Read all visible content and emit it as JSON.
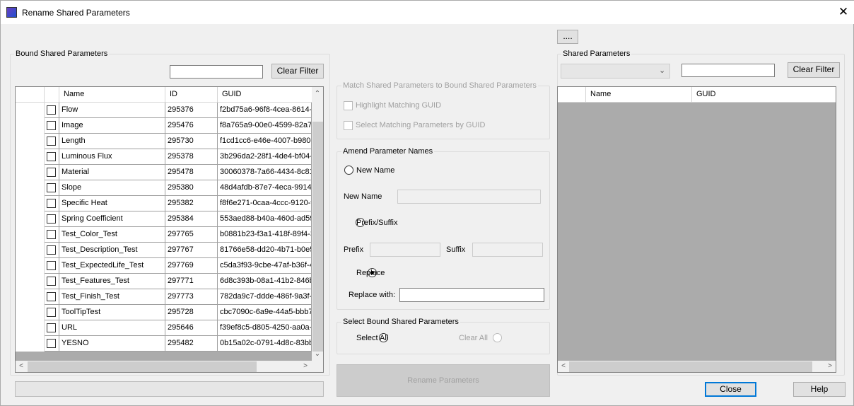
{
  "window": {
    "title": "Rename Shared Parameters",
    "close_icon": "close-icon"
  },
  "browse_button": "....",
  "bound": {
    "group_label": "Bound Shared Parameters",
    "filter_value": "",
    "clear_filter": "Clear Filter",
    "columns": [
      "Name",
      "ID",
      "GUID"
    ],
    "rows": [
      {
        "name": "Flow",
        "id": "295376",
        "guid": "f2bd75a6-96f8-4cea-8614-e"
      },
      {
        "name": "Image",
        "id": "295476",
        "guid": "f8a765a9-00e0-4599-82a7-"
      },
      {
        "name": "Length",
        "id": "295730",
        "guid": "f1cd1cc6-e46e-4007-b980-"
      },
      {
        "name": "Luminous Flux",
        "id": "295378",
        "guid": "3b296da2-28f1-4de4-bf04-c"
      },
      {
        "name": "Material",
        "id": "295478",
        "guid": "30060378-7a66-4434-8c81"
      },
      {
        "name": "Slope",
        "id": "295380",
        "guid": "48d4afdb-87e7-4eca-9914-"
      },
      {
        "name": "Specific Heat",
        "id": "295382",
        "guid": "f8f6e271-0caa-4ccc-9120-f"
      },
      {
        "name": "Spring Coefficient",
        "id": "295384",
        "guid": "553aed88-b40a-460d-ad59"
      },
      {
        "name": "Test_Color_Test",
        "id": "297765",
        "guid": "b0881b23-f3a1-418f-89f4-3"
      },
      {
        "name": "Test_Description_Test",
        "id": "297767",
        "guid": "81766e58-dd20-4b71-b0e5"
      },
      {
        "name": "Test_ExpectedLife_Test",
        "id": "297769",
        "guid": "c5da3f93-9cbe-47af-b36f-4"
      },
      {
        "name": "Test_Features_Test",
        "id": "297771",
        "guid": "6d8c393b-08a1-41b2-846b"
      },
      {
        "name": "Test_Finish_Test",
        "id": "297773",
        "guid": "782da9c7-ddde-486f-9a3f-c"
      },
      {
        "name": "ToolTipTest",
        "id": "295728",
        "guid": "cbc7090c-6a9e-44a5-bbb7"
      },
      {
        "name": "URL",
        "id": "295646",
        "guid": "f39ef8c5-d805-4250-aa0a-3"
      },
      {
        "name": "YESNO",
        "id": "295482",
        "guid": "0b15a02c-0791-4d8c-83bb"
      }
    ]
  },
  "match": {
    "group_label": "Match Shared Parameters to Bound Shared Parameters",
    "highlight": "Highlight Matching GUID",
    "select": "Select Matching Parameters by GUID"
  },
  "amend": {
    "group_label": "Amend Parameter Names",
    "new_name_radio": "New Name",
    "new_name_label": "New Name",
    "new_name_value": "",
    "prefix_suffix_radio": "Prefix/Suffix",
    "prefix_label": "Prefix",
    "prefix_value": "",
    "suffix_label": "Suffix",
    "suffix_value": "",
    "replace_radio": "Replace",
    "replace_with_label": "Replace with:",
    "replace_with_value": "",
    "selected": "Replace"
  },
  "select_bound": {
    "group_label": "Select Bound Shared Parameters",
    "select_all": "Select All",
    "clear_all": "Clear All"
  },
  "rename_button": "Rename Parameters",
  "shared": {
    "group_label": "Shared Parameters",
    "combo_value": "",
    "filter_value": "",
    "clear_filter": "Clear Filter",
    "columns": [
      "Name",
      "GUID"
    ]
  },
  "footer": {
    "close": "Close",
    "help": "Help"
  }
}
